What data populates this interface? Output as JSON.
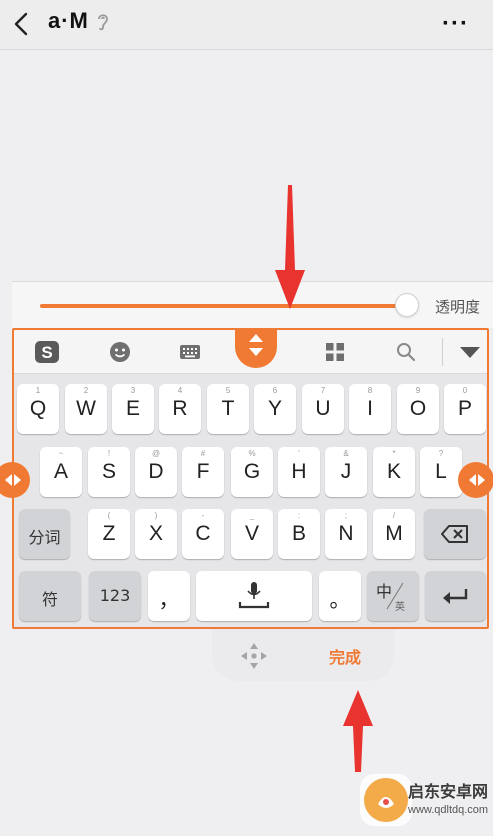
{
  "header": {
    "title": "a·M",
    "icons": [
      "back-arrow-icon",
      "ear-icon",
      "more-icon"
    ],
    "more_label": "···"
  },
  "opacity": {
    "label": "透明度",
    "level": 0.9
  },
  "toolbar": {
    "icons": [
      "sogou-logo-icon",
      "emoji-icon",
      "keyboard-icon",
      "move-up-down-icon",
      "grid-apps-icon",
      "search-icon",
      "collapse-icon"
    ]
  },
  "keys": {
    "row1": [
      {
        "ch": "Q",
        "hint": "1"
      },
      {
        "ch": "W",
        "hint": "2"
      },
      {
        "ch": "E",
        "hint": "3"
      },
      {
        "ch": "R",
        "hint": "4"
      },
      {
        "ch": "T",
        "hint": "5"
      },
      {
        "ch": "Y",
        "hint": "6"
      },
      {
        "ch": "U",
        "hint": "7"
      },
      {
        "ch": "I",
        "hint": "8"
      },
      {
        "ch": "O",
        "hint": "9"
      },
      {
        "ch": "P",
        "hint": "0"
      }
    ],
    "row2": [
      {
        "ch": "A",
        "hint": "~"
      },
      {
        "ch": "S",
        "hint": "!"
      },
      {
        "ch": "D",
        "hint": "@"
      },
      {
        "ch": "F",
        "hint": "#"
      },
      {
        "ch": "G",
        "hint": "%"
      },
      {
        "ch": "H",
        "hint": "'"
      },
      {
        "ch": "J",
        "hint": "&"
      },
      {
        "ch": "K",
        "hint": "*"
      },
      {
        "ch": "L",
        "hint": "?"
      }
    ],
    "row3": [
      {
        "ch": "Z",
        "hint": "("
      },
      {
        "ch": "X",
        "hint": ")"
      },
      {
        "ch": "C",
        "hint": "-"
      },
      {
        "ch": "V",
        "hint": "_"
      },
      {
        "ch": "B",
        "hint": ":"
      },
      {
        "ch": "N",
        "hint": ";"
      },
      {
        "ch": "M",
        "hint": "/"
      }
    ],
    "fenci": "分词",
    "fu": "符",
    "num": "123",
    "comma": "，",
    "period": "。",
    "zh": "中",
    "en": "英"
  },
  "bottom": {
    "done": "完成"
  },
  "colors": {
    "accent": "#f07a34",
    "annotation": "#e8332f"
  },
  "watermark": {
    "title": "启东安卓网",
    "url": "www.qdltdq.com"
  }
}
